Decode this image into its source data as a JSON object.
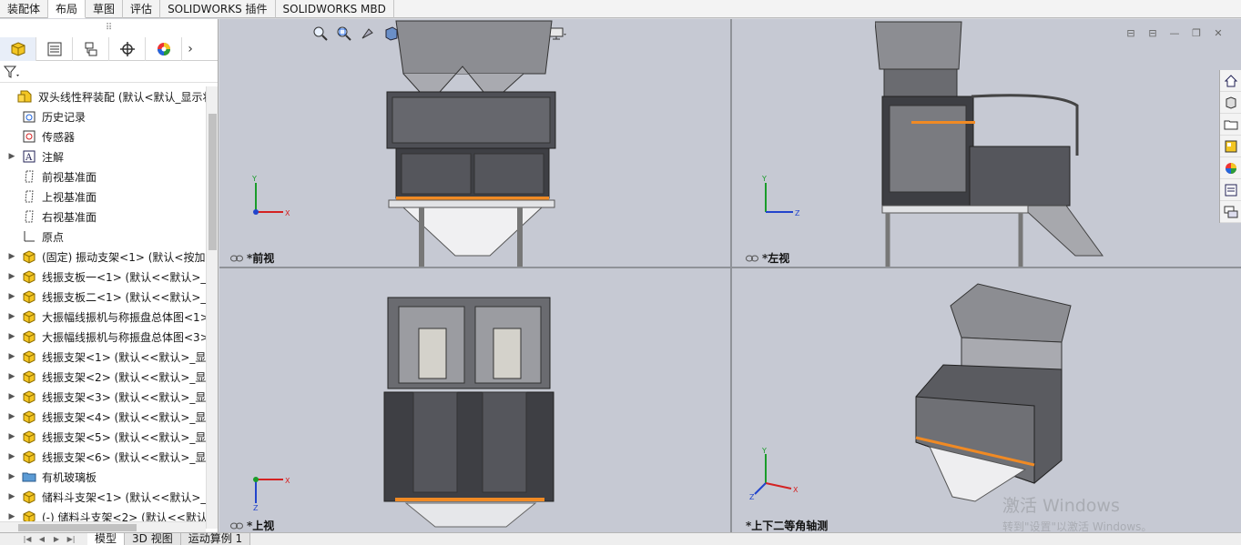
{
  "tabs": [
    "装配体",
    "布局",
    "草图",
    "评估",
    "SOLIDWORKS 插件",
    "SOLIDWORKS MBD"
  ],
  "active_tab": "布局",
  "panel": {
    "grip": "⠿",
    "tabs": [
      "feature-manager",
      "property-manager",
      "configuration-manager",
      "dimxpert-manager",
      "display-manager"
    ]
  },
  "tree": [
    {
      "label": "双头线性秤装配  (默认<默认_显示状态",
      "icon": "assembly",
      "expand": "",
      "level": 0
    },
    {
      "label": "历史记录",
      "icon": "history",
      "expand": "",
      "level": 1
    },
    {
      "label": "传感器",
      "icon": "sensor",
      "expand": "",
      "level": 1
    },
    {
      "label": "注解",
      "icon": "annotation",
      "expand": "▶",
      "level": 1
    },
    {
      "label": "前视基准面",
      "icon": "plane",
      "expand": "",
      "level": 1
    },
    {
      "label": "上视基准面",
      "icon": "plane",
      "expand": "",
      "level": 1
    },
    {
      "label": "右视基准面",
      "icon": "plane",
      "expand": "",
      "level": 1
    },
    {
      "label": "原点",
      "icon": "origin",
      "expand": "",
      "level": 1
    },
    {
      "label": "(固定) 振动支架<1> (默认<按加工",
      "icon": "part",
      "expand": "▶",
      "level": 1
    },
    {
      "label": "线振支板一<1> (默认<<默认>_显",
      "icon": "part",
      "expand": "▶",
      "level": 1
    },
    {
      "label": "线振支板二<1> (默认<<默认>_显",
      "icon": "part",
      "expand": "▶",
      "level": 1
    },
    {
      "label": "大振幅线振机与称振盘总体图<1>",
      "icon": "part",
      "expand": "▶",
      "level": 1
    },
    {
      "label": "大振幅线振机与称振盘总体图<3>",
      "icon": "part",
      "expand": "▶",
      "level": 1
    },
    {
      "label": "线振支架<1> (默认<<默认>_显示",
      "icon": "part",
      "expand": "▶",
      "level": 1
    },
    {
      "label": "线振支架<2> (默认<<默认>_显示",
      "icon": "part",
      "expand": "▶",
      "level": 1
    },
    {
      "label": "线振支架<3> (默认<<默认>_显示",
      "icon": "part",
      "expand": "▶",
      "level": 1
    },
    {
      "label": "线振支架<4> (默认<<默认>_显示",
      "icon": "part",
      "expand": "▶",
      "level": 1
    },
    {
      "label": "线振支架<5> (默认<<默认>_显示",
      "icon": "part",
      "expand": "▶",
      "level": 1
    },
    {
      "label": "线振支架<6> (默认<<默认>_显示",
      "icon": "part",
      "expand": "▶",
      "level": 1
    },
    {
      "label": "有机玻璃板",
      "icon": "folder",
      "expand": "▶",
      "level": 1
    },
    {
      "label": "储料斗支架<1> (默认<<默认>_显",
      "icon": "part",
      "expand": "▶",
      "level": 1
    },
    {
      "label": "(-) 储料斗支架<2> (默认<<默认",
      "icon": "part",
      "expand": "▶",
      "level": 1
    }
  ],
  "bottom_tabs": [
    "模型",
    "3D 视图",
    "运动算例 1"
  ],
  "active_bottom_tab": "模型",
  "views": {
    "front": "*前视",
    "left": "*左视",
    "top": "*上视",
    "iso": "*上下二等角轴测"
  },
  "axes": {
    "x": "X",
    "y": "Y",
    "z": "Z"
  },
  "watermark": {
    "line1": "激活 Windows",
    "line2": "转到\"设置\"以激活 Windows。"
  },
  "colors": {
    "viewport_bg": "#c6c9d3",
    "part_icon": "#f3c623",
    "accent_orange": "#f08a24"
  }
}
